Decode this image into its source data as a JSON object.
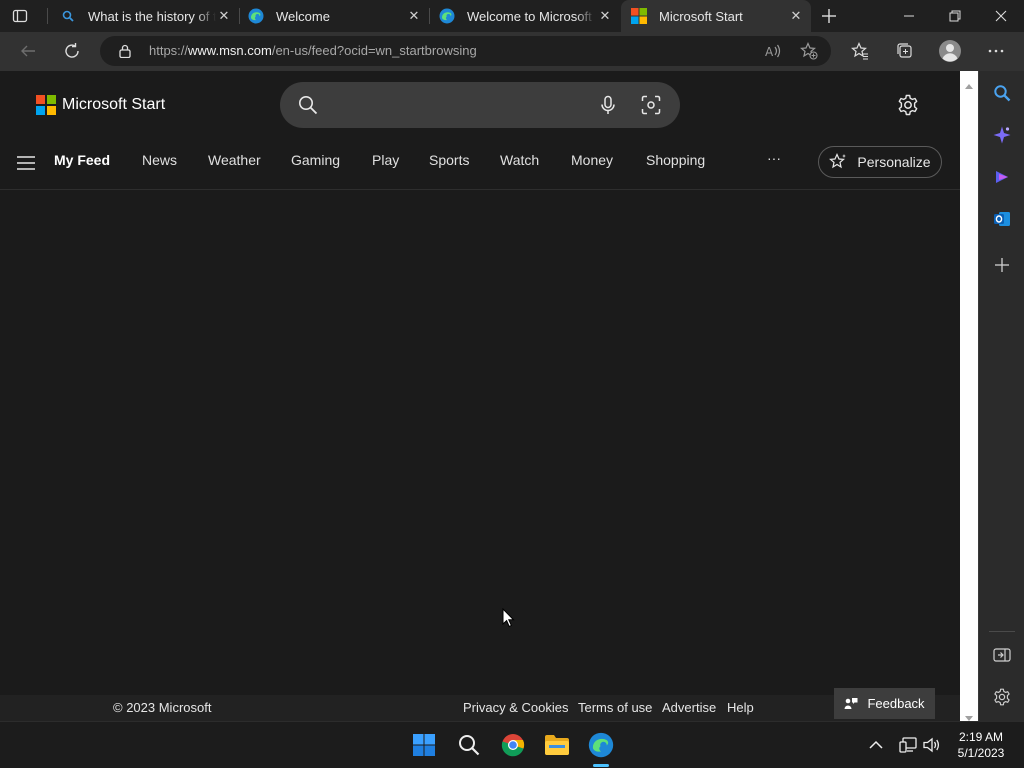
{
  "tabs": [
    {
      "label": "What is the history of th",
      "icon": "search-icon",
      "active": false
    },
    {
      "label": "Welcome",
      "icon": "edge-icon",
      "active": false
    },
    {
      "label": "Welcome to Microsoft E",
      "icon": "edge-icon",
      "active": false
    },
    {
      "label": "Microsoft Start",
      "icon": "microsoft-logo-icon",
      "active": true
    }
  ],
  "address_bar": {
    "url_prefix": "https://",
    "url_domain": "www.msn.com",
    "url_path": "/en-us/feed?ocid=wn_startbrowsing"
  },
  "brand": {
    "name": "Microsoft Start"
  },
  "search": {
    "placeholder": ""
  },
  "nav": {
    "items": [
      "My Feed",
      "News",
      "Weather",
      "Gaming",
      "Play",
      "Sports",
      "Watch",
      "Money",
      "Shopping"
    ],
    "more": "···",
    "personalize": "Personalize"
  },
  "footer": {
    "copyright": "© 2023 Microsoft",
    "privacy": "Privacy & Cookies",
    "terms": "Terms of use",
    "advertise": "Advertise",
    "help": "Help",
    "feedback": "Feedback"
  },
  "taskbar": {
    "time": "2:19 AM",
    "date": "5/1/2023"
  },
  "colors": {
    "accent_blue": "#3a96dd",
    "ms_red": "#f25022",
    "ms_green": "#7fba00",
    "ms_blue": "#00a4ef",
    "ms_yellow": "#ffb900"
  }
}
